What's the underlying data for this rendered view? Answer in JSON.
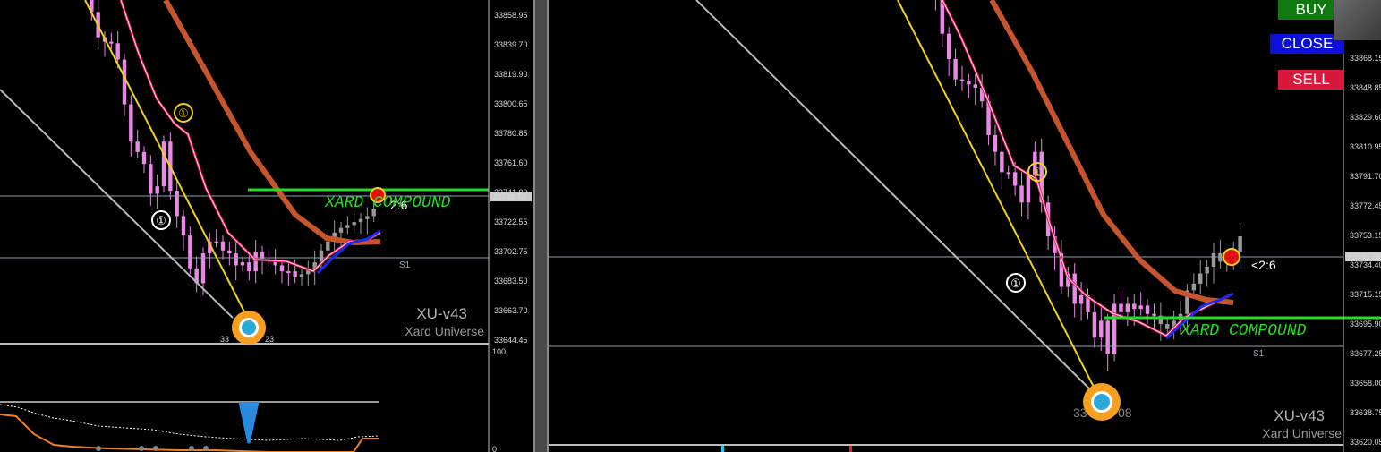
{
  "colors": {
    "background": "#000000",
    "bull_candle": "#e889e6",
    "bear_candle": "#9a9a9a",
    "fast_ma": "#e0185a",
    "slow_ma": "#c6542c",
    "trend_line": "#f2d21a",
    "diagonal": "#b9b9b9",
    "signal_line": "#22dd22",
    "buy": "#107a10",
    "close": "#0c10d8",
    "sell": "#d8183c"
  },
  "buttons": {
    "buy": "BUY",
    "close": "CLOSE",
    "sell": "SELL"
  },
  "left_chart": {
    "watermark_title": "XU-v43",
    "watermark_subtitle": "Xard Universe",
    "compound_label": "XARD COMPOUND",
    "ratio_label": "2:6",
    "s1_label": "S1",
    "marker_label": "①",
    "low_label": "33",
    "low_label_2": "23",
    "price_ticks": [
      "33858.95",
      "33839.70",
      "33819.90",
      "33800.65",
      "33780.85",
      "33761.60",
      "33741.80",
      "33722.55",
      "33702.75",
      "33683.50",
      "33663.70",
      "33644.45"
    ],
    "current_price": "33738.73",
    "indicator_ticks": [
      "100",
      "0"
    ]
  },
  "right_chart": {
    "watermark_title": "XU-v43",
    "watermark_subtitle": "Xard Universe",
    "compound_label": "XARD COMPOUND",
    "ratio_label": "<2:6",
    "s1_label": "S1",
    "marker_label": "①",
    "low_label": "33",
    "low_label_2": "08",
    "price_ticks": [
      "33868.15",
      "33848.85",
      "33829.60",
      "33810.95",
      "33791.70",
      "33772.45",
      "33753.15",
      "33734.40",
      "33715.15",
      "33695.90",
      "33677.25",
      "33658.00",
      "33638.75",
      "33620.05"
    ],
    "current_price": "33739.28"
  },
  "chart_data": [
    {
      "type": "candlestick",
      "title": "",
      "ylim": [
        33640,
        33870
      ],
      "price_ticks": [
        33858.95,
        33839.7,
        33819.9,
        33800.65,
        33780.85,
        33761.6,
        33741.8,
        33722.55,
        33702.75,
        33683.5,
        33663.7,
        33644.45
      ],
      "current_price": 33738.73,
      "horizontal_lines": [
        33738.73,
        33704.0
      ],
      "signal_level": 33746.0,
      "close_path": [
        33880,
        33862,
        33845,
        33842,
        33841,
        33830,
        33800,
        33775,
        33768,
        33760,
        33740,
        33745,
        33775,
        33742,
        33725,
        33712,
        33690,
        33680,
        33700,
        33708,
        33708,
        33702,
        33700,
        33692,
        33694,
        33688,
        33701,
        33696,
        33695,
        33692,
        33688,
        33688,
        33684,
        33686,
        33689,
        33694,
        33702,
        33708,
        33714,
        33717,
        33719,
        33721,
        33723,
        33725,
        33730
      ]
    },
    {
      "type": "candlestick",
      "title": "",
      "ylim": [
        33617,
        33880
      ],
      "price_ticks": [
        33868.15,
        33848.85,
        33829.6,
        33810.95,
        33791.7,
        33772.45,
        33753.15,
        33734.4,
        33715.15,
        33695.9,
        33677.25,
        33658.0,
        33638.75,
        33620.05
      ],
      "current_price": 33739.28,
      "horizontal_lines": [
        33739.28,
        33680.0
      ],
      "signal_level": 33700.0,
      "close_path": [
        33885,
        33880,
        33860,
        33845,
        33833,
        33832,
        33830,
        33828,
        33820,
        33800,
        33790,
        33778,
        33778,
        33770,
        33760,
        33776,
        33790,
        33760,
        33740,
        33730,
        33710,
        33718,
        33700,
        33705,
        33695,
        33680,
        33690,
        33670,
        33700,
        33695,
        33700,
        33697,
        33699,
        33694,
        33693,
        33688,
        33685,
        33690,
        33694,
        33708,
        33712,
        33718,
        33722,
        33730,
        33725,
        33728,
        33731,
        33740
      ]
    }
  ]
}
